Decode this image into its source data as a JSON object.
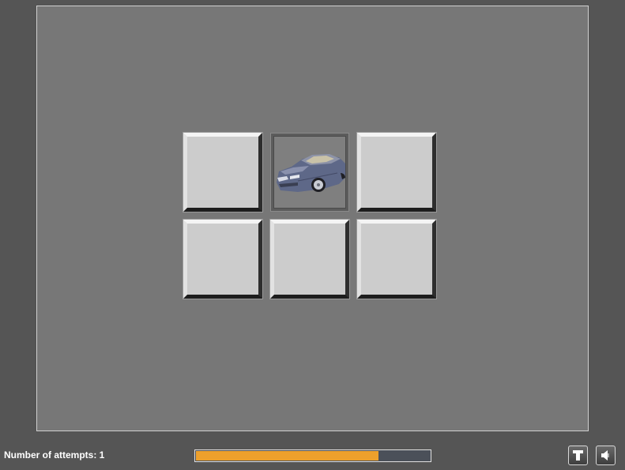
{
  "footer": {
    "attempts_label": "Number of attempts: 1"
  },
  "progress": {
    "fraction": 0.78
  },
  "cards": [
    {
      "state": "face-down"
    },
    {
      "state": "face-up",
      "image": "car-image"
    },
    {
      "state": "face-down"
    },
    {
      "state": "face-down"
    },
    {
      "state": "face-down"
    },
    {
      "state": "face-down"
    }
  ],
  "toolbar": {
    "text_icon": "text-icon",
    "sound_icon": "speaker-icon"
  },
  "colors": {
    "background": "#555555",
    "board": "#777777",
    "card_face": "#cccccc",
    "progress_fill": "#eda02c",
    "progress_track": "#4b5059"
  }
}
